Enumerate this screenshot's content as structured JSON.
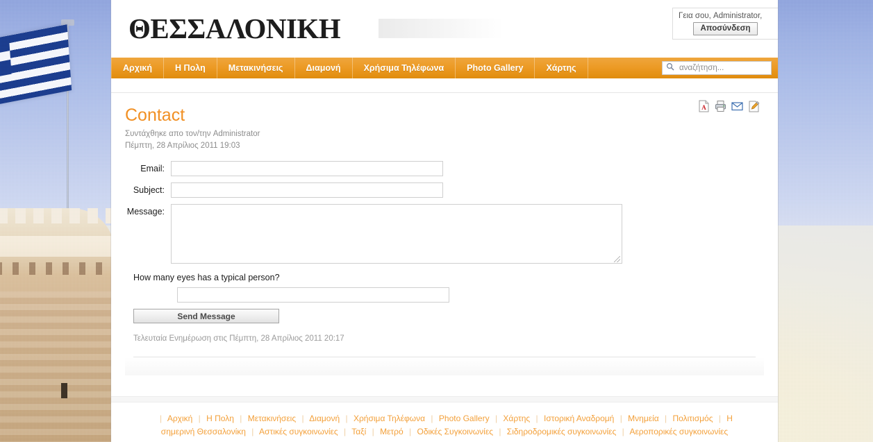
{
  "site": {
    "logo_text": "ΘΕΣΣΑΛΟΝΙΚΗ",
    "accent_color": "#f19024",
    "nav_color_top": "#efa63d",
    "nav_color_bottom": "#e08c0d"
  },
  "user": {
    "greeting": "Γεια σου, Administrator,",
    "logout_label": "Αποσύνδεση"
  },
  "nav": {
    "items": [
      {
        "label": "Αρχική"
      },
      {
        "label": "Η Πολη"
      },
      {
        "label": "Μετακινήσεις"
      },
      {
        "label": "Διαμονή"
      },
      {
        "label": "Χρήσιμα Τηλέφωνα"
      },
      {
        "label": "Photo Gallery"
      },
      {
        "label": "Χάρτης"
      }
    ],
    "search": {
      "placeholder": "αναζήτηση...",
      "value": "",
      "icon": "search-icon"
    }
  },
  "article": {
    "title": "Contact",
    "byline": "Συντάχθηκε απο τον/την Administrator",
    "pubdate": "Πέμπτη, 28 Απρίλιος 2011 19:03",
    "last_updated": "Τελευταία Ενημέρωση στις Πέμπτη, 28 Απρίλιος 2011 20:17",
    "actions": [
      {
        "name": "pdf-icon",
        "title": "PDF"
      },
      {
        "name": "print-icon",
        "title": "Print"
      },
      {
        "name": "email-icon",
        "title": "E-mail"
      },
      {
        "name": "edit-icon",
        "title": "Edit"
      }
    ]
  },
  "form": {
    "email_label": "Email:",
    "email_value": "",
    "subject_label": "Subject:",
    "subject_value": "",
    "message_label": "Message:",
    "message_value": "",
    "captcha_question": "How many eyes has a typical person?",
    "captcha_value": "",
    "send_label": "Send Message"
  },
  "footer": {
    "row1": [
      "Αρχική",
      "Η Πολη",
      "Μετακινήσεις",
      "Διαμονή",
      "Χρήσιμα Τηλέφωνα",
      "Photo Gallery",
      "Χάρτης",
      "Ιστορική Αναδρομή",
      "Μνημεία",
      "Πολιτισμός",
      "Η"
    ],
    "row2": [
      "σημερινή Θεσσαλονίκη",
      "Αστικές συγκοινωνίες",
      "Ταξί",
      "Μετρό",
      "Οδικές Συγκοινωνίες",
      "Σιδηροδρομικές συγκοινωνίες",
      "Αεροπορικές συγκοινωνίες"
    ],
    "separator": "|"
  }
}
